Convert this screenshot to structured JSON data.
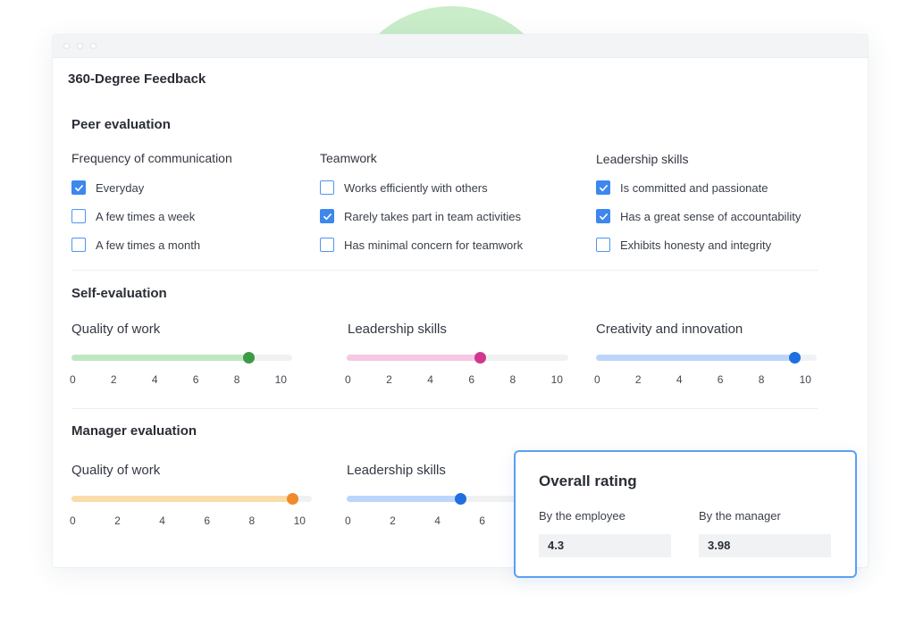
{
  "window": {
    "title": "360-Degree Feedback"
  },
  "peer_evaluation": {
    "title": "Peer evaluation",
    "groups": [
      {
        "label": "Frequency of communication",
        "options": [
          {
            "label": "Everyday",
            "checked": true
          },
          {
            "label": "A few times a week",
            "checked": false
          },
          {
            "label": "A few times a month",
            "checked": false
          }
        ]
      },
      {
        "label": "Teamwork",
        "options": [
          {
            "label": "Works efficiently with others",
            "checked": false
          },
          {
            "label": "Rarely takes part in team activities",
            "checked": true
          },
          {
            "label": "Has minimal concern for teamwork",
            "checked": false
          }
        ]
      },
      {
        "label": "Leadership skills",
        "options": [
          {
            "label": "Is committed and passionate",
            "checked": true
          },
          {
            "label": "Has a great sense of accountability",
            "checked": true
          },
          {
            "label": "Exhibits honesty and integrity",
            "checked": false
          }
        ]
      }
    ]
  },
  "self_evaluation": {
    "title": "Self-evaluation",
    "sliders": [
      {
        "label": "Quality of work",
        "value": 8,
        "max": 10,
        "ticks": [
          "0",
          "2",
          "4",
          "6",
          "8",
          "10"
        ],
        "fill_color": "#bfe8c2",
        "thumb_color": "#3d9a45"
      },
      {
        "label": "Leadership skills",
        "value": 6,
        "max": 10,
        "ticks": [
          "0",
          "2",
          "4",
          "6",
          "8",
          "10"
        ],
        "fill_color": "#f6c8e4",
        "thumb_color": "#d0378f"
      },
      {
        "label": "Creativity and innovation",
        "value": 9,
        "max": 10,
        "ticks": [
          "0",
          "2",
          "4",
          "6",
          "8",
          "10"
        ],
        "fill_color": "#bcd6fb",
        "thumb_color": "#1f6fe0"
      }
    ]
  },
  "manager_evaluation": {
    "title": "Manager evaluation",
    "sliders": [
      {
        "label": "Quality of work",
        "value": 9.2,
        "max": 10,
        "ticks": [
          "0",
          "2",
          "4",
          "6",
          "8",
          "10"
        ],
        "fill_color": "#f9dcaa",
        "thumb_color": "#f08a2a"
      },
      {
        "label": "Leadership skills",
        "value": 5.3,
        "max": 10,
        "ticks": [
          "0",
          "2",
          "4",
          "6"
        ],
        "fill_color": "#bcd6fb",
        "thumb_color": "#1f6fe0"
      }
    ]
  },
  "overall_rating": {
    "title": "Overall rating",
    "employee_label": "By the employee",
    "employee_value": "4.3",
    "manager_label": "By the manager",
    "manager_value": "3.98"
  },
  "colors": {
    "accent": "#3d87ee",
    "card_border": "#5aa0f2",
    "deco_circle": "#c9ecc9"
  }
}
